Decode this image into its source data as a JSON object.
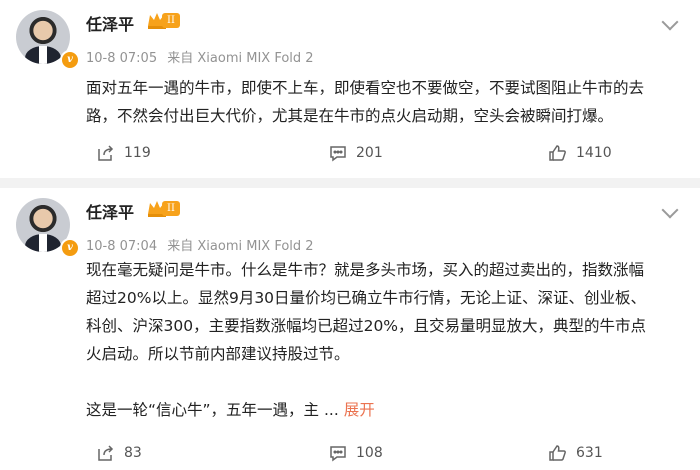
{
  "posts": [
    {
      "author": "任泽平",
      "level": "II",
      "time": "10-8 07:05",
      "source": "来自 Xiaomi MIX Fold 2",
      "lines": [
        "面对五年一遇的牛市，即使不上车，即使看空也不要做空，不要试图阻止牛市的去",
        "路，不然会付出巨大代价，尤其是在牛市的点火启动期，空头会被瞬间打爆。"
      ],
      "shares": "119",
      "comments": "201",
      "likes": "1410"
    },
    {
      "author": "任泽平",
      "level": "II",
      "time": "10-8 07:04",
      "source": "来自 Xiaomi MIX Fold 2",
      "lines": [
        "现在毫无疑问是牛市。什么是牛市？就是多头市场，买入的超过卖出的，指数涨幅",
        "超过20%以上。显然9月30日量价均已确立牛市行情，无论上证、深证、创业板、",
        "科创、沪深300，主要指数涨幅均已超过20%，且交易量明显放大，典型的牛市点",
        "火启动。所以节前内部建议持股过节。"
      ],
      "last_line": "这是一轮“信心牛”，五年一遇，主 ...",
      "more_label": "展开",
      "shares": "83",
      "comments": "108",
      "likes": "631"
    }
  ],
  "icons": {
    "share": "share-icon",
    "comment": "comment-icon",
    "like": "like-icon",
    "verified": "verified-badge-icon",
    "menu": "chevron-down-icon"
  },
  "colors": {
    "accent": "#eb7350",
    "verified": "#f49c10",
    "meta": "#939393"
  }
}
